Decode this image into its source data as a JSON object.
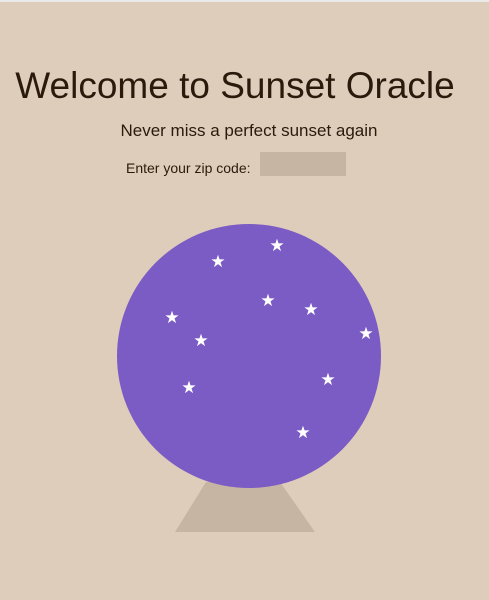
{
  "header": {
    "title": "Welcome to Sunset Oracle",
    "subtitle": "Never miss a perfect sunset again"
  },
  "zip_form": {
    "label": "Enter your zip code:",
    "value": "",
    "placeholder": ""
  },
  "crystal_ball": {
    "star_glyph": "★",
    "ball_color": "#7b5bc4",
    "stand_color": "#c7b5a4",
    "star_color": "#ffffff"
  },
  "colors": {
    "background": "#dfcdbb",
    "text": "#2a1a0c",
    "input_background": "#c7b5a4"
  }
}
